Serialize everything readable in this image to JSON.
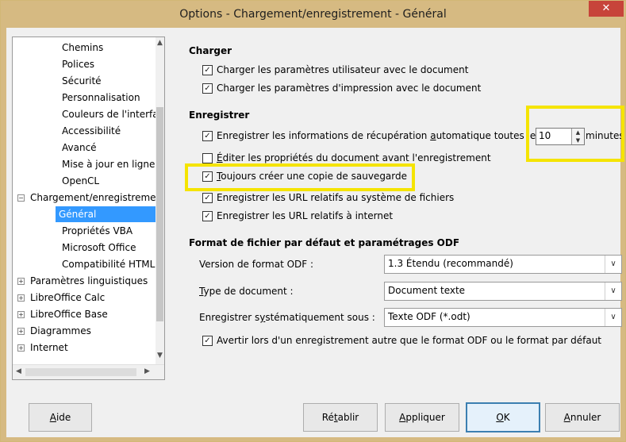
{
  "window": {
    "title": "Options - Chargement/enregistrement - Général",
    "close_glyph": "✕"
  },
  "tree": {
    "items": [
      {
        "label": "Chemins"
      },
      {
        "label": "Polices"
      },
      {
        "label": "Sécurité"
      },
      {
        "label": "Personnalisation"
      },
      {
        "label": "Couleurs de l'interface"
      },
      {
        "label": "Accessibilité"
      },
      {
        "label": "Avancé"
      },
      {
        "label": "Mise à jour en ligne"
      },
      {
        "label": "OpenCL"
      },
      {
        "label": "Chargement/enregistrement",
        "expander": "−"
      },
      {
        "label": "Général",
        "selected": true
      },
      {
        "label": "Propriétés VBA"
      },
      {
        "label": "Microsoft Office"
      },
      {
        "label": "Compatibilité HTML"
      },
      {
        "label": "Paramètres linguistiques",
        "expander": "+"
      },
      {
        "label": "LibreOffice Calc",
        "expander": "+"
      },
      {
        "label": "LibreOffice Base",
        "expander": "+"
      },
      {
        "label": "Diagrammes",
        "expander": "+"
      },
      {
        "label": "Internet",
        "expander": "+"
      }
    ]
  },
  "charger": {
    "title": "Charger",
    "opt1": "Charger les paramètres utilisateur avec le document",
    "opt2": "Charger les paramètres d'impression avec le document"
  },
  "enregistrer": {
    "title": "Enregistrer",
    "autosave_prefix": "Enregistrer les informations de récupération ",
    "autosave_underlined": "a",
    "autosave_rest": "utomatique toutes les :",
    "autosave_value": "10",
    "autosave_unit": "minutes",
    "edit_props_u": "É",
    "edit_props": "diter les propriétés du document avant l'enregistrement",
    "backup_u": "T",
    "backup": "oujours créer une copie de sauvegarde",
    "url_fs": "Enregistrer les URL relatifs au système de fichiers",
    "url_net": "Enregistrer les URL relatifs à internet"
  },
  "format": {
    "title": "Format de fichier par défaut et paramétrages ODF",
    "version_label": "Version de format ODF :",
    "version_value": "1.3 Étendu (recommandé)",
    "doctype_u": "T",
    "doctype_label": "ype de document :",
    "doctype_value": "Document texte",
    "saveas_label_a": "Enregistrer s",
    "saveas_u": "y",
    "saveas_label_b": "stématiquement sous :",
    "saveas_value": "Texte ODF (*.odt)",
    "warn": "Avertir lors d'un enregistrement autre que le format ODF ou le format par défaut"
  },
  "buttons": {
    "help_u": "A",
    "help": "ide",
    "reset_a": "Ré",
    "reset_u": "t",
    "reset_b": "ablir",
    "apply_u": "A",
    "apply": "ppliquer",
    "ok_u": "O",
    "ok": "K",
    "cancel_u": "A",
    "cancel": "nnuler"
  },
  "colors": {
    "titlebar": "#d6ba82",
    "selection": "#3399ff",
    "highlight": "#f5e400",
    "close": "#c7443a"
  }
}
